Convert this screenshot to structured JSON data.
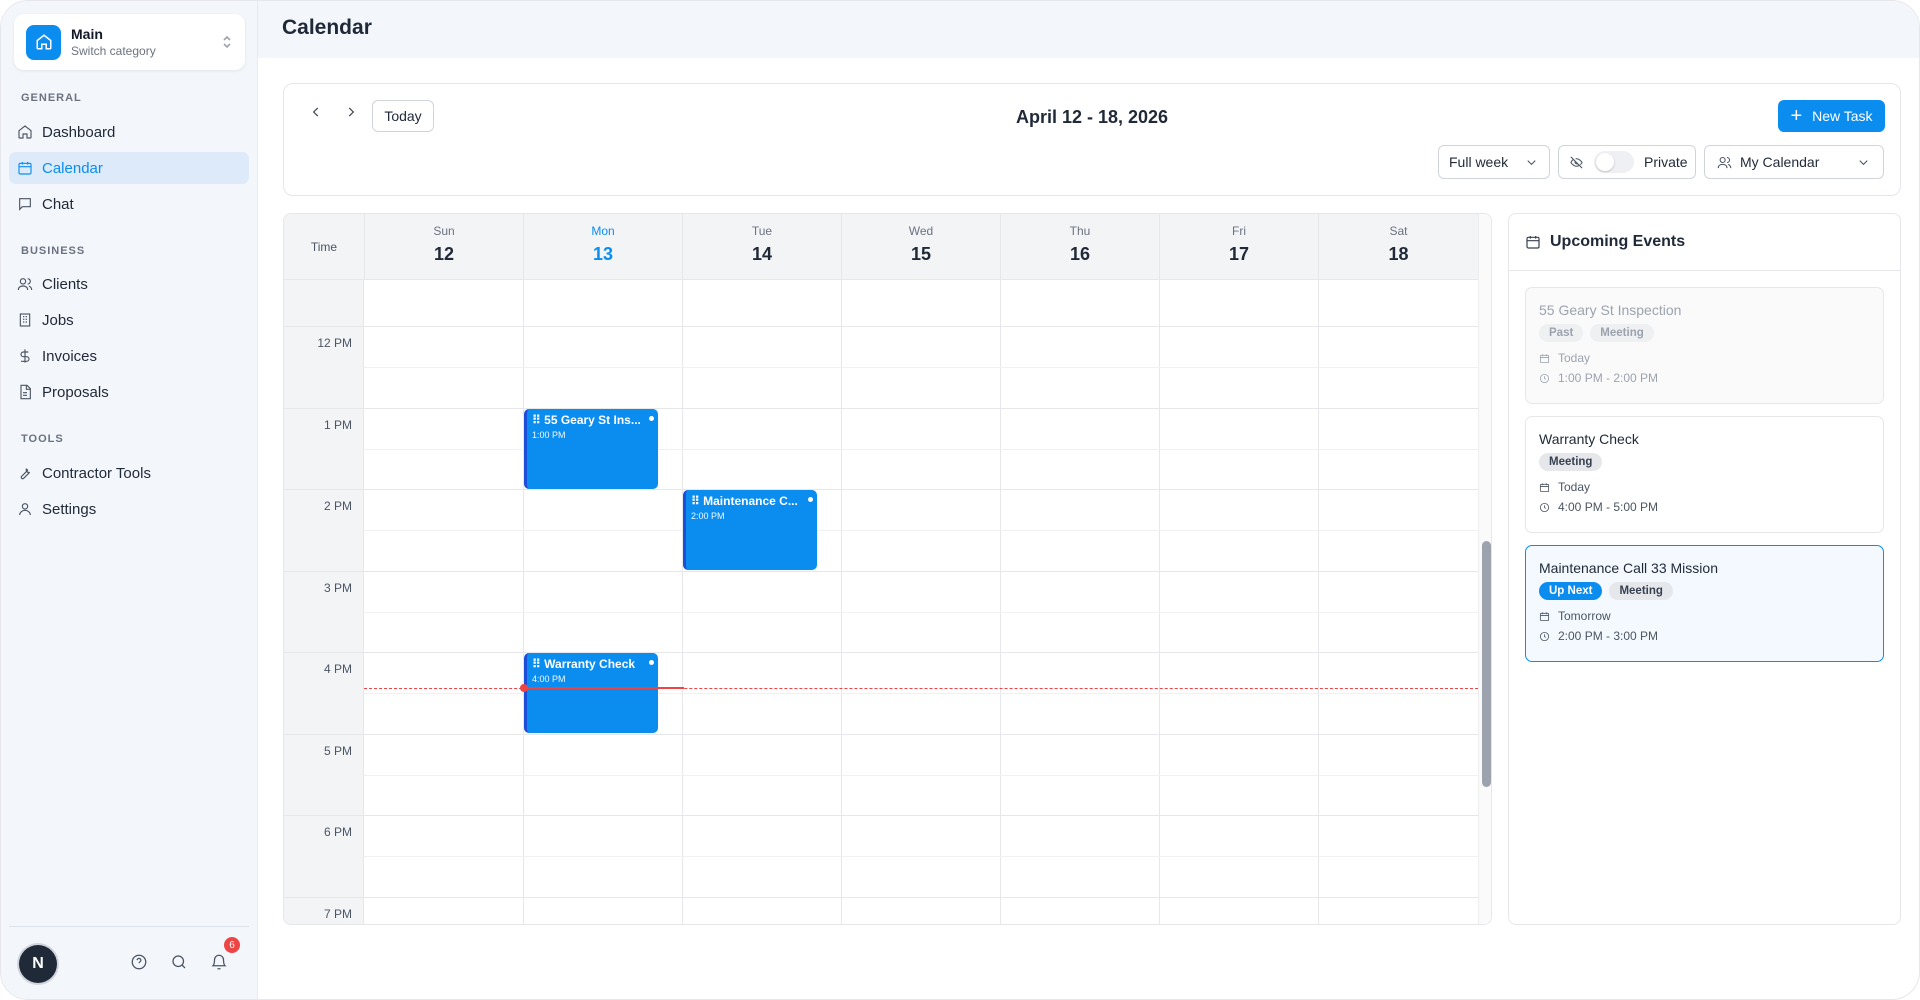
{
  "sidebar": {
    "category": {
      "name": "Main",
      "subtitle": "Switch category"
    },
    "sections": {
      "general": "GENERAL",
      "business": "BUSINESS",
      "tools": "TOOLS"
    },
    "items": {
      "dashboard": "Dashboard",
      "calendar": "Calendar",
      "chat": "Chat",
      "clients": "Clients",
      "jobs": "Jobs",
      "invoices": "Invoices",
      "proposals": "Proposals",
      "contractor_tools": "Contractor Tools",
      "settings": "Settings"
    },
    "active_item": "calendar",
    "avatar_initial": "N",
    "notification_count": "6"
  },
  "header": {
    "title": "Calendar"
  },
  "toolbar": {
    "range_title": "April 12 - 18, 2026",
    "today_label": "Today",
    "new_task_label": "New Task",
    "view_select": "Full week",
    "private_label": "Private",
    "private_enabled": false,
    "calendar_select": "My Calendar"
  },
  "calendar": {
    "time_header": "Time",
    "days": [
      {
        "name": "Sun",
        "date": "12"
      },
      {
        "name": "Mon",
        "date": "13"
      },
      {
        "name": "Tue",
        "date": "14"
      },
      {
        "name": "Wed",
        "date": "15"
      },
      {
        "name": "Thu",
        "date": "16"
      },
      {
        "name": "Fri",
        "date": "17"
      },
      {
        "name": "Sat",
        "date": "18"
      }
    ],
    "today_index": 1,
    "hours": [
      "12 PM",
      "1 PM",
      "2 PM",
      "3 PM",
      "4 PM",
      "5 PM",
      "6 PM",
      "7 PM"
    ],
    "events": [
      {
        "title": "55 Geary St Ins...",
        "time": "1:00 PM"
      },
      {
        "title": "Maintenance C...",
        "time": "2:00 PM"
      },
      {
        "title": "Warranty Check",
        "time": "4:00 PM"
      }
    ]
  },
  "upcoming": {
    "title": "Upcoming Events",
    "events": [
      {
        "title": "55 Geary St Inspection",
        "status": "Past",
        "type": "Meeting",
        "day": "Today",
        "time": "1:00 PM - 2:00 PM"
      },
      {
        "title": "Warranty Check",
        "type": "Meeting",
        "day": "Today",
        "time": "4:00 PM - 5:00 PM"
      },
      {
        "title": "Maintenance Call 33 Mission",
        "status": "Up Next",
        "type": "Meeting",
        "day": "Tomorrow",
        "time": "2:00 PM - 3:00 PM"
      }
    ]
  },
  "colors": {
    "accent": "#0b8df0",
    "now_line": "#ef4444",
    "event_border": "#1d4ed8"
  }
}
